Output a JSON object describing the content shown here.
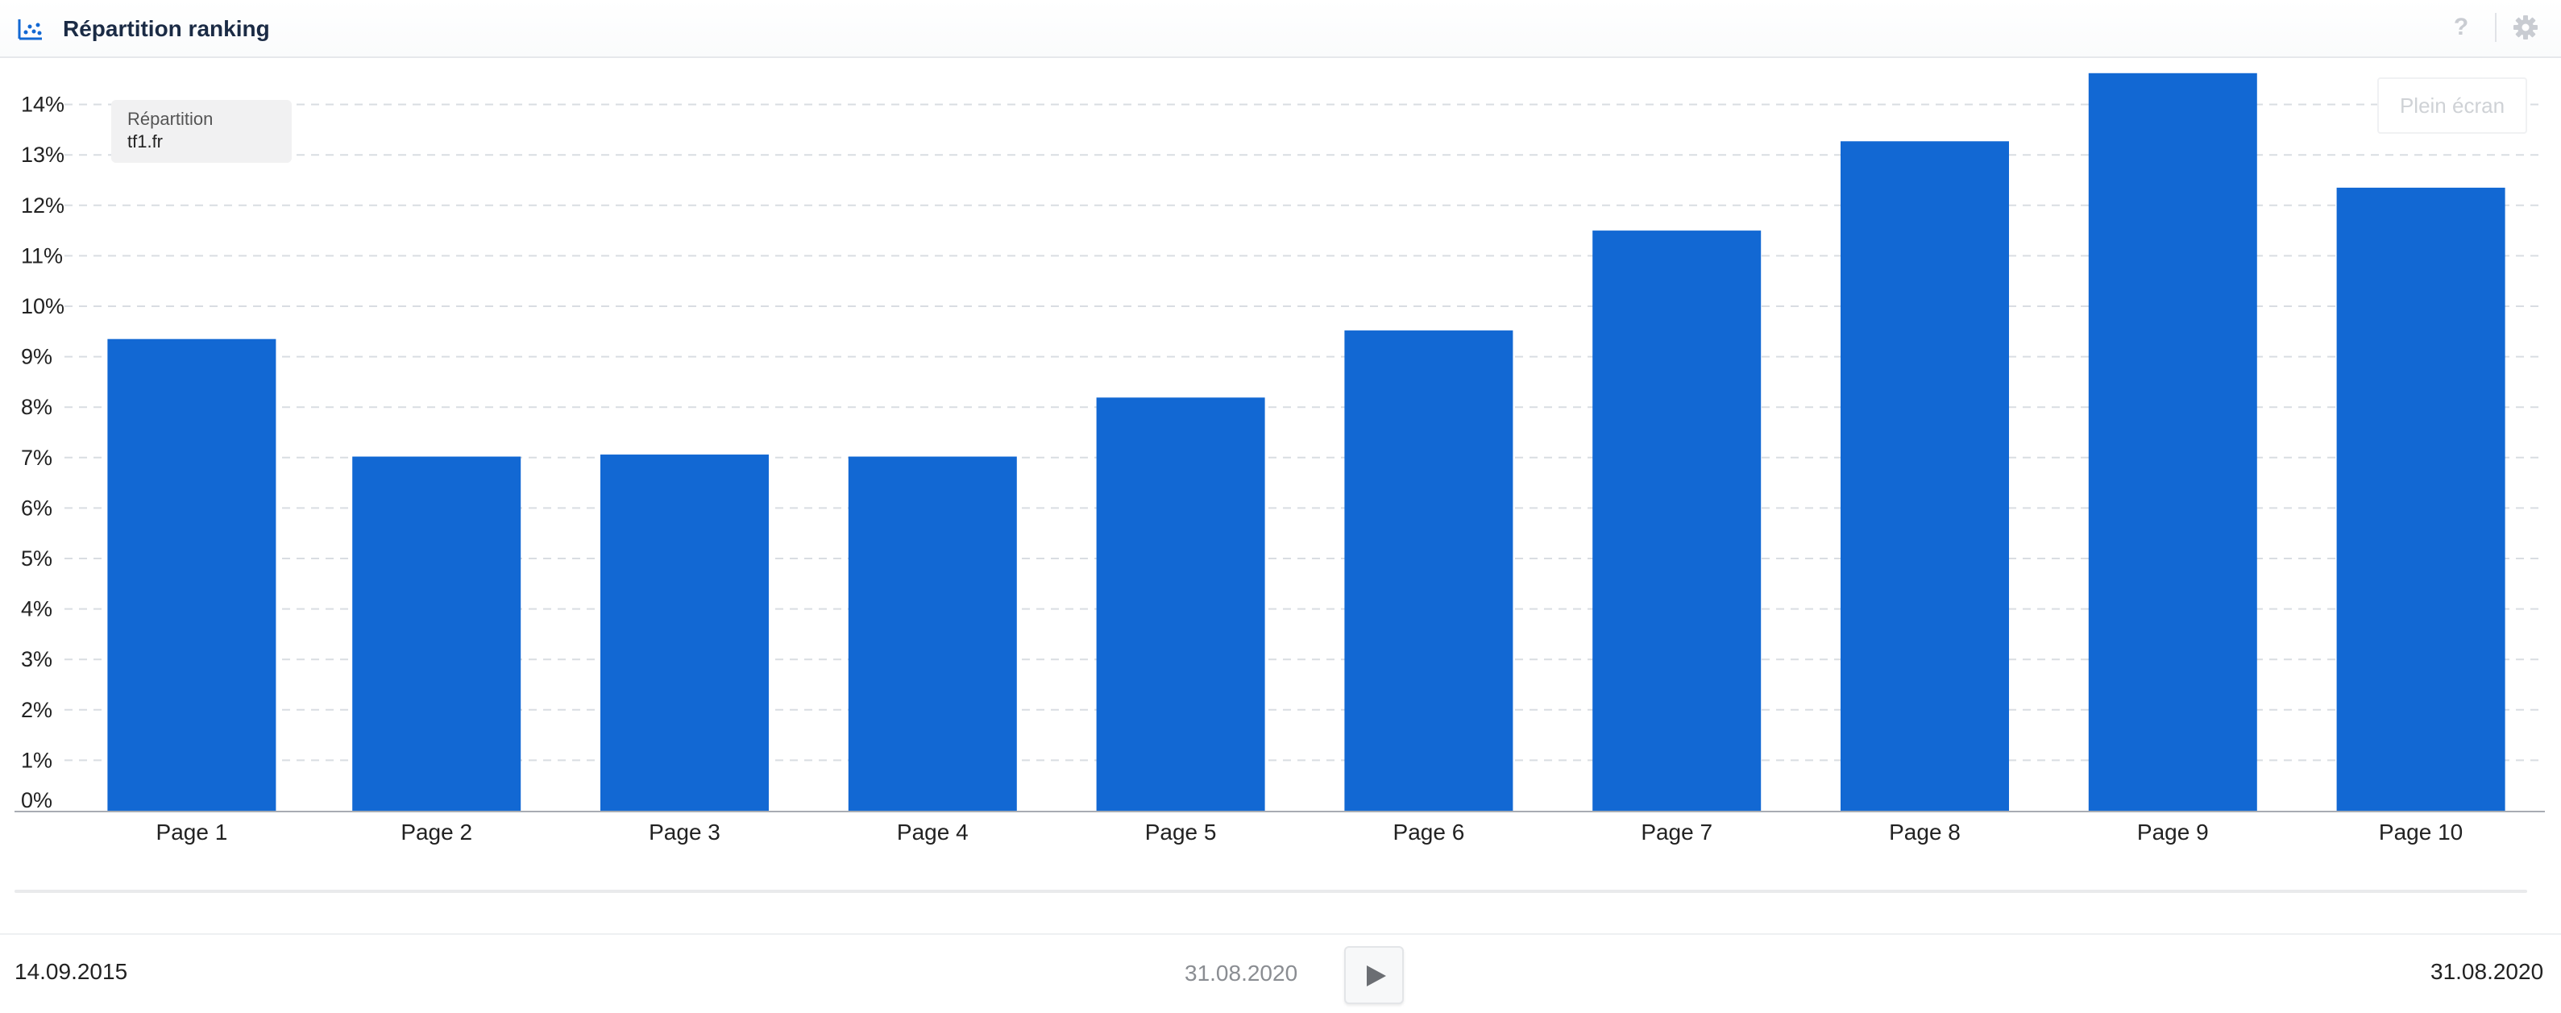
{
  "header": {
    "title": "Répartition ranking",
    "chart_icon": "scatter-chart-icon",
    "help_label": "?",
    "help_icon": "question-icon",
    "settings_icon": "gear-icon"
  },
  "legend": {
    "series_type": "Répartition",
    "series_name": "tf1.fr"
  },
  "fullscreen_label": "Plein écran",
  "timeline": {
    "start_date": "14.09.2015",
    "current_date": "31.08.2020",
    "end_date": "31.08.2020",
    "play_icon": "play-icon"
  },
  "colors": {
    "bar": "#1268d3",
    "grid": "#d9dde2",
    "axis": "#a8acb3"
  },
  "chart_data": {
    "type": "bar",
    "categories": [
      "Page 1",
      "Page 2",
      "Page 3",
      "Page 4",
      "Page 5",
      "Page 6",
      "Page 7",
      "Page 8",
      "Page 9",
      "Page 10"
    ],
    "series": [
      {
        "name": "tf1.fr",
        "values": [
          9.35,
          7.02,
          7.06,
          7.02,
          8.19,
          9.52,
          11.5,
          13.27,
          14.62,
          12.35
        ]
      }
    ],
    "ylim": [
      0,
      14
    ],
    "yticks": [
      "0%",
      "1%",
      "2%",
      "3%",
      "4%",
      "5%",
      "6%",
      "7%",
      "8%",
      "9%",
      "10%",
      "11%",
      "12%",
      "13%",
      "14%"
    ],
    "grid": true,
    "legend_position": "top-left"
  }
}
